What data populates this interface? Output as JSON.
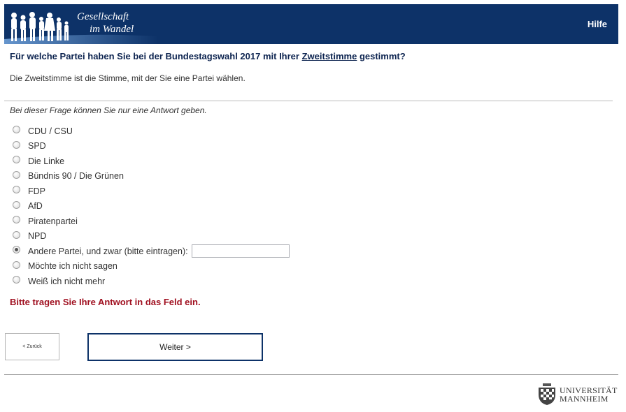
{
  "header": {
    "logo_line1": "Gesellschaft",
    "logo_line2": "im Wandel",
    "help_label": "Hilfe"
  },
  "question": {
    "before": "Für welche Partei haben Sie bei der Bundestagswahl 2017 mit Ihrer ",
    "emphasis": "Zweitstimme",
    "after": " gestimmt?"
  },
  "hint": "Die Zweitstimme ist die Stimme, mit der Sie eine Partei wählen.",
  "instruction": "Bei dieser Frage können Sie nur eine Antwort geben.",
  "options": [
    {
      "label": "CDU / CSU",
      "checked": false
    },
    {
      "label": "SPD",
      "checked": false
    },
    {
      "label": "Die Linke",
      "checked": false
    },
    {
      "label": "Bündnis 90 / Die Grünen",
      "checked": false
    },
    {
      "label": "FDP",
      "checked": false
    },
    {
      "label": "AfD",
      "checked": false
    },
    {
      "label": "Piratenpartei",
      "checked": false
    },
    {
      "label": "NPD",
      "checked": false
    },
    {
      "label": "Andere Partei, und zwar (bitte eintragen):",
      "checked": true
    },
    {
      "label": "Möchte ich nicht sagen",
      "checked": false
    },
    {
      "label": "Weiß ich nicht mehr",
      "checked": false
    }
  ],
  "other_value": "",
  "error": "Bitte tragen Sie Ihre Antwort in das Feld ein.",
  "nav": {
    "back_label": "< Zurück",
    "next_label": "Weiter >"
  },
  "footer": {
    "uni_line1": "UNIVERSITÄT",
    "uni_line2": "MANNHEIM"
  },
  "colors": {
    "header_bg": "#0d3268",
    "error": "#a01020",
    "question": "#0d2450"
  }
}
